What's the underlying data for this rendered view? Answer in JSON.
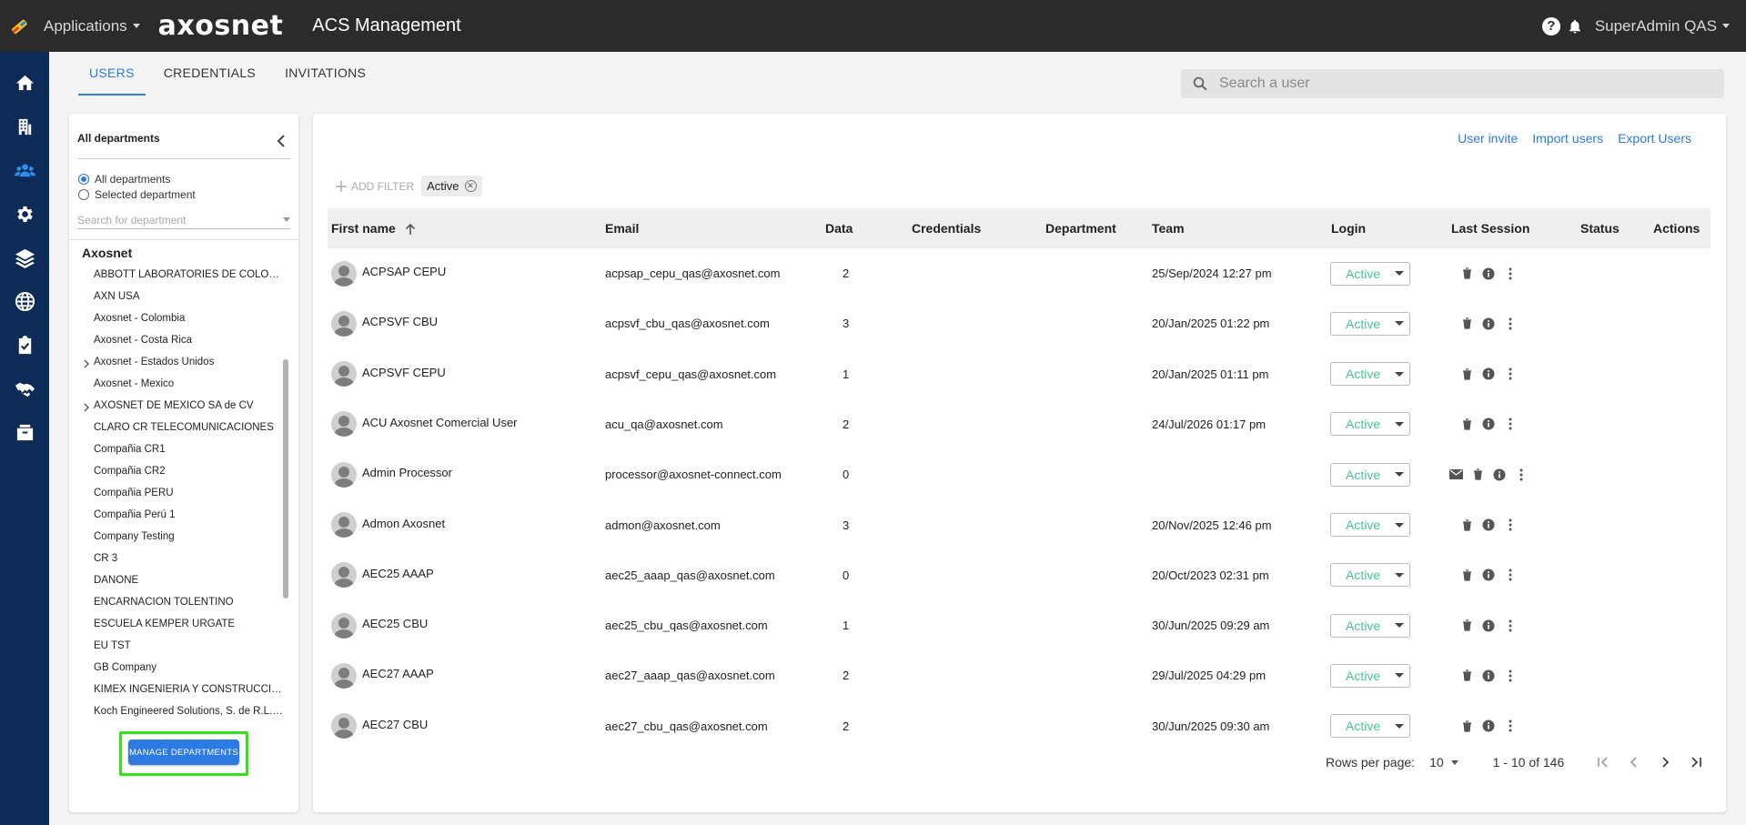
{
  "header": {
    "apps_label": "Applications",
    "brand": "axosnet",
    "title": "ACS Management",
    "user_label": "SuperAdmin QAS"
  },
  "tabs": [
    {
      "label": "USERS",
      "active": true
    },
    {
      "label": "CREDENTIALS",
      "active": false
    },
    {
      "label": "INVITATIONS",
      "active": false
    }
  ],
  "search": {
    "placeholder": "Search a user"
  },
  "departments": {
    "title": "All departments",
    "radio_all": "All departments",
    "radio_selected": "Selected department",
    "search_placeholder": "Search for department",
    "root": "Axosnet",
    "items": [
      {
        "label": "ABBOTT LABORATORIES DE COLOMBIA S.A.S.",
        "expandable": false
      },
      {
        "label": "AXN USA",
        "expandable": false
      },
      {
        "label": "Axosnet - Colombia",
        "expandable": false
      },
      {
        "label": "Axosnet - Costa Rica",
        "expandable": false
      },
      {
        "label": "Axosnet - Estados Unidos",
        "expandable": true
      },
      {
        "label": "Axosnet - Mexico",
        "expandable": false
      },
      {
        "label": "AXOSNET DE MEXICO SA de CV",
        "expandable": true
      },
      {
        "label": "CLARO CR TELECOMUNICACIONES",
        "expandable": false
      },
      {
        "label": "Compañia CR1",
        "expandable": false
      },
      {
        "label": "Compañia CR2",
        "expandable": false
      },
      {
        "label": "Compañia PERU",
        "expandable": false
      },
      {
        "label": "Compañia Perú 1",
        "expandable": false
      },
      {
        "label": "Company Testing",
        "expandable": false
      },
      {
        "label": "CR 3",
        "expandable": false
      },
      {
        "label": "DANONE",
        "expandable": false
      },
      {
        "label": "ENCARNACION TOLENTINO",
        "expandable": false
      },
      {
        "label": "ESCUELA KEMPER URGATE",
        "expandable": false
      },
      {
        "label": "EU TST",
        "expandable": false
      },
      {
        "label": "GB Company",
        "expandable": false
      },
      {
        "label": "KIMEX INGENIERIA Y CONSTRUCCION",
        "expandable": false
      },
      {
        "label": "Koch Engineered Solutions, S. de R.L. de C.V.",
        "expandable": false
      }
    ],
    "manage_button": "MANAGE DEPARTMENTS"
  },
  "actions": {
    "user_invite": "User invite",
    "import_users": "Import users",
    "export_users": "Export Users"
  },
  "filters": {
    "add_filter": "ADD FILTER",
    "chips": [
      "Active"
    ]
  },
  "table": {
    "columns": [
      "First name",
      "Email",
      "Data",
      "Credentials",
      "Department",
      "Team",
      "Login",
      "Last Session",
      "Status",
      "Actions"
    ],
    "rows": [
      {
        "first_name": "ACPSAP CEPU",
        "email": "acpsap_cepu_qas@axosnet.com",
        "data": "2",
        "team": "25/Sep/2024 12:27 pm",
        "login": "Active",
        "mail_action": false
      },
      {
        "first_name": "ACPSVF CBU",
        "email": "acpsvf_cbu_qas@axosnet.com",
        "data": "3",
        "team": "20/Jan/2025 01:22 pm",
        "login": "Active",
        "mail_action": false
      },
      {
        "first_name": "ACPSVF CEPU",
        "email": "acpsvf_cepu_qas@axosnet.com",
        "data": "1",
        "team": "20/Jan/2025 01:11 pm",
        "login": "Active",
        "mail_action": false
      },
      {
        "first_name": "ACU Axosnet Comercial User",
        "email": "acu_qa@axosnet.com",
        "data": "2",
        "team": "24/Jul/2026 01:17 pm",
        "login": "Active",
        "mail_action": false
      },
      {
        "first_name": "Admin Processor",
        "email": "processor@axosnet-connect.com",
        "data": "0",
        "team": "",
        "login": "Active",
        "mail_action": true
      },
      {
        "first_name": "Admon Axosnet",
        "email": "admon@axosnet.com",
        "data": "3",
        "team": "20/Nov/2025 12:46 pm",
        "login": "Active",
        "mail_action": false
      },
      {
        "first_name": "AEC25 AAAP",
        "email": "aec25_aaap_qas@axosnet.com",
        "data": "0",
        "team": "20/Oct/2023 02:31 pm",
        "login": "Active",
        "mail_action": false
      },
      {
        "first_name": "AEC25 CBU",
        "email": "aec25_cbu_qas@axosnet.com",
        "data": "1",
        "team": "30/Jun/2025 09:29 am",
        "login": "Active",
        "mail_action": false
      },
      {
        "first_name": "AEC27 AAAP",
        "email": "aec27_aaap_qas@axosnet.com",
        "data": "2",
        "team": "29/Jul/2025 04:29 pm",
        "login": "Active",
        "mail_action": false
      },
      {
        "first_name": "AEC27 CBU",
        "email": "aec27_cbu_qas@axosnet.com",
        "data": "2",
        "team": "30/Jun/2025 09:30 am",
        "login": "Active",
        "mail_action": false
      }
    ]
  },
  "pagination": {
    "rows_per_page_label": "Rows per page:",
    "rows_per_page": "10",
    "range": "1 - 10 of 146"
  },
  "colors": {
    "topbar": "#2b2b2b",
    "leftnav": "#0e2a57",
    "accent": "#2c7be5",
    "active_status": "#49c497",
    "highlight": "#33e31a"
  }
}
